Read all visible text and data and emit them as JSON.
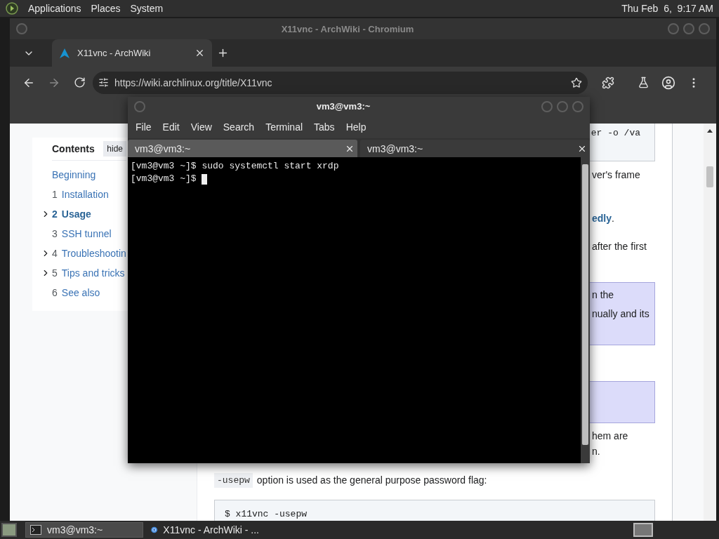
{
  "top_panel": {
    "menus": [
      "Applications",
      "Places",
      "System"
    ],
    "clock": "Thu Feb  6,  9:17 AM"
  },
  "browser": {
    "title": "X11vnc - ArchWiki - Chromium",
    "tabs": [
      {
        "label": "X11vnc - ArchWiki",
        "selected": true
      }
    ],
    "url": "https://wiki.archlinux.org/title/X11vnc",
    "toc": {
      "heading": "Contents",
      "hide": "hide",
      "items": [
        {
          "label": "Beginning",
          "expandable": false,
          "selected": false
        },
        {
          "number": "1",
          "label": "Installation",
          "expandable": false,
          "selected": false
        },
        {
          "number": "2",
          "label": "Usage",
          "expandable": true,
          "selected": true
        },
        {
          "number": "3",
          "label": "SSH tunnel",
          "expandable": false,
          "selected": false
        },
        {
          "number": "4",
          "label": "Troubleshootin",
          "expandable": true,
          "selected": false
        },
        {
          "number": "5",
          "label": "Tips and tricks",
          "expandable": true,
          "selected": false
        },
        {
          "number": "6",
          "label": "See also",
          "expandable": false,
          "selected": false
        }
      ]
    },
    "article": [
      {
        "kind": "code",
        "text": "er -o /va"
      },
      {
        "kind": "para",
        "lines": [
          {
            "text": "ver's frame"
          }
        ]
      },
      {
        "kind": "para",
        "lines": [
          {
            "link": "edly",
            "text": "."
          }
        ]
      },
      {
        "kind": "para",
        "lines": [
          {
            "text": "after the first"
          }
        ]
      },
      {
        "kind": "note",
        "lines": [
          {
            "text": "n the"
          },
          {
            "text": "nually and its"
          }
        ]
      },
      {
        "kind": "note"
      },
      {
        "kind": "para",
        "lines": [
          {
            "text": "hem are"
          },
          {
            "text": "n."
          }
        ]
      },
      {
        "kind": "usage",
        "code": "-usepw",
        "text": "option is used as the general purpose password flag:"
      },
      {
        "kind": "code_full",
        "text": "$ x11vnc -usepw"
      }
    ]
  },
  "terminal": {
    "title": "vm3@vm3:~",
    "menus": [
      "File",
      "Edit",
      "View",
      "Search",
      "Terminal",
      "Tabs",
      "Help"
    ],
    "tabs": [
      {
        "label": "vm3@vm3:~",
        "selected": true
      },
      {
        "label": "vm3@vm3:~",
        "selected": false
      }
    ],
    "lines": [
      "[vm3@vm3 ~]$ sudo systemctl start xrdp",
      "[vm3@vm3 ~]$ "
    ]
  },
  "taskbar": {
    "tasks": [
      {
        "label": "vm3@vm3:~",
        "kind": "terminal",
        "selected": true
      },
      {
        "label": "X11vnc - ArchWiki - ...",
        "kind": "browser",
        "selected": false
      }
    ]
  }
}
